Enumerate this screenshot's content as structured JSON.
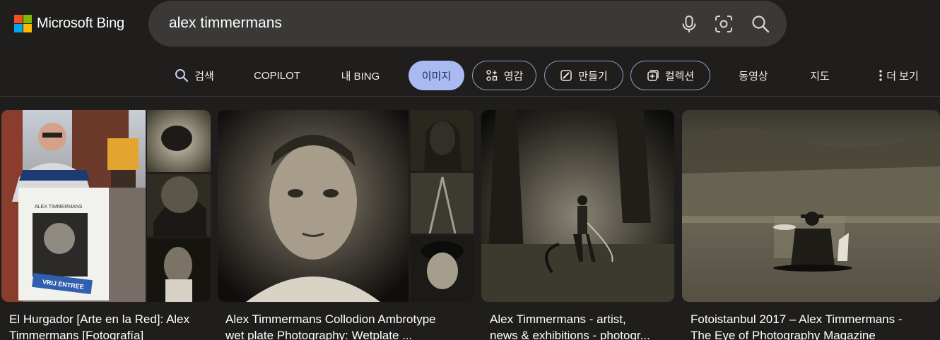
{
  "brand": {
    "name": "Microsoft Bing",
    "colors": [
      "#f25022",
      "#7fba00",
      "#00a4ef",
      "#ffb900"
    ]
  },
  "search": {
    "query": "alex timmermans"
  },
  "nav": {
    "search": "검색",
    "copilot": "COPILOT",
    "mybing": "내 BING",
    "images": "이미지",
    "inspiration": "영감",
    "create": "만들기",
    "collections": "컬렉션",
    "videos": "동영상",
    "maps": "지도",
    "more": "더 보기"
  },
  "results": [
    {
      "title_line1": "El Hurgador [Arte en la Red]: Alex",
      "title_line2": "Timmermans [Fotografía]",
      "poster_name": "ALEX TIMMERMANS",
      "poster_banner": "VRIJ ENTREE"
    },
    {
      "title_line1": "Alex Timmermans Collodion Ambrotype",
      "title_line2": "wet plate Photography: Wetplate ..."
    },
    {
      "title_line1": "Alex Timmermans - artist,",
      "title_line2": "news & exhibitions - photogr..."
    },
    {
      "title_line1": "Fotoistanbul 2017 – Alex Timmermans -",
      "title_line2": "The Eye of Photography Magazine"
    }
  ],
  "accent": "#a9b9f2"
}
